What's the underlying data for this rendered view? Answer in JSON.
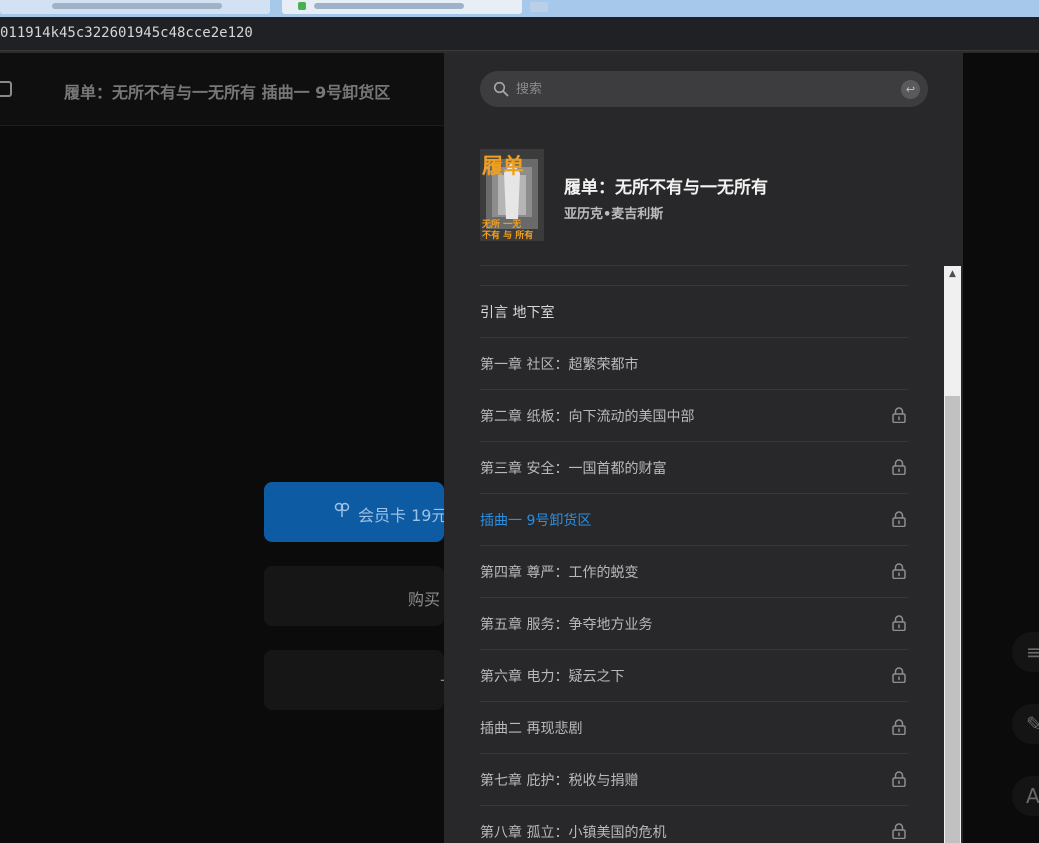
{
  "browser": {
    "url": "011914k45c322601945c48cce2e120"
  },
  "reader": {
    "header_title": "履单：无所不有与一无所有 插曲一 9号卸货区",
    "member_card_label": "会员卡 19元",
    "buy_label": "购买",
    "third_label": "-"
  },
  "panel": {
    "search_placeholder": "搜索",
    "search_enter_icon": "↩",
    "book": {
      "title": "履单：无所不有与一无所有",
      "author": "亚历克•麦吉利斯",
      "cover_big_text": "履单",
      "cover_line1": "无所  一无",
      "cover_line2": "不有  与 所有",
      "cover_colors": {
        "bg": "#3b3b3b",
        "title": "#f0a020"
      }
    },
    "chapters": [
      {
        "label": "引言 地下室",
        "locked": false,
        "state": "free"
      },
      {
        "label": "第一章 社区：超繁荣都市",
        "locked": false,
        "state": "normal"
      },
      {
        "label": "第二章 纸板：向下流动的美国中部",
        "locked": true,
        "state": "normal"
      },
      {
        "label": "第三章 安全：一国首都的财富",
        "locked": true,
        "state": "normal"
      },
      {
        "label": "插曲一 9号卸货区",
        "locked": true,
        "state": "current"
      },
      {
        "label": "第四章 尊严：工作的蜕变",
        "locked": true,
        "state": "normal"
      },
      {
        "label": "第五章 服务：争夺地方业务",
        "locked": true,
        "state": "normal"
      },
      {
        "label": "第六章 电力：疑云之下",
        "locked": true,
        "state": "normal"
      },
      {
        "label": "插曲二 再现悲剧",
        "locked": true,
        "state": "normal"
      },
      {
        "label": "第七章 庇护：税收与捐赠",
        "locked": true,
        "state": "normal"
      },
      {
        "label": "第八章 孤立：小镇美国的危机",
        "locked": true,
        "state": "normal"
      }
    ],
    "accent_color": "#2b8ee0"
  },
  "side_buttons": [
    {
      "icon": "menu-icon",
      "glyph": "≡"
    },
    {
      "icon": "note-icon",
      "glyph": "✎"
    },
    {
      "icon": "font-icon",
      "glyph": "A"
    }
  ]
}
